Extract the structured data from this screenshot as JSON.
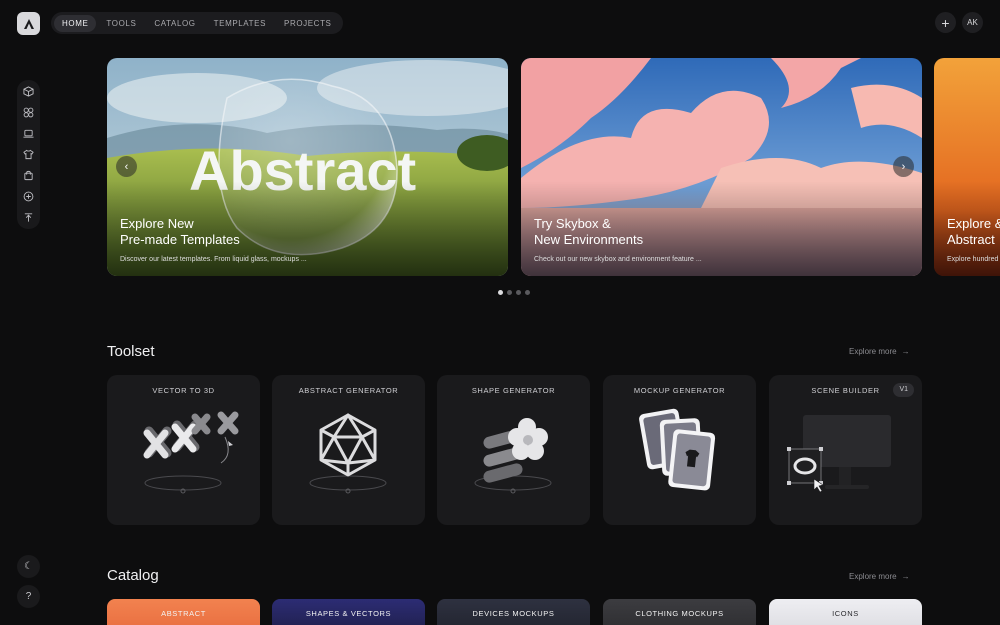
{
  "header": {
    "logo": "brand-logo",
    "nav": [
      {
        "label": "HOME",
        "active": true
      },
      {
        "label": "TOOLS"
      },
      {
        "label": "CATALOG"
      },
      {
        "label": "TEMPLATES"
      },
      {
        "label": "PROJECTS"
      }
    ],
    "add_icon": "+",
    "avatar_initials": "AK"
  },
  "sidebar": {
    "items": [
      "cube-icon",
      "shapes-icon",
      "laptop-icon",
      "tshirt-icon",
      "bag-icon",
      "plus-circle-icon",
      "upload-icon"
    ],
    "theme_icon": "☾",
    "help_icon": "?"
  },
  "hero": {
    "slides": [
      {
        "title_line1": "Explore New",
        "title_line2": "Pre-made Templates",
        "subtitle": "Discover our latest templates. From liquid glass, mockups ...",
        "art_word": "Abstract"
      },
      {
        "title_line1": "Try Skybox &",
        "title_line2": "New Environments",
        "subtitle": "Check out our new skybox and environment feature ..."
      },
      {
        "title_line1": "Explore &",
        "title_line2": "Abstract",
        "subtitle": "Explore hundred"
      }
    ],
    "prev_icon": "‹",
    "next_icon": "›",
    "active_dot": 0,
    "dot_count": 4
  },
  "toolset": {
    "title": "Toolset",
    "explore": "Explore more",
    "arrow": "→",
    "tools": [
      {
        "label": "VECTOR TO 3D"
      },
      {
        "label": "ABSTRACT GENERATOR"
      },
      {
        "label": "SHAPE GENERATOR"
      },
      {
        "label": "MOCKUP GENERATOR"
      },
      {
        "label": "SCENE BUILDER",
        "badge": "V1"
      }
    ]
  },
  "catalog": {
    "title": "Catalog",
    "explore": "Explore more",
    "arrow": "→",
    "items": [
      {
        "label": "ABSTRACT",
        "color": "#f0794a"
      },
      {
        "label": "SHAPES & VECTORS",
        "color": "#2a2a6a"
      },
      {
        "label": "DEVICES MOCKUPS",
        "color": "#2a2d3a"
      },
      {
        "label": "CLOTHING MOCKUPS",
        "color": "#3a3a3e"
      },
      {
        "label": "ICONS",
        "color": "#e6e6ea"
      }
    ]
  }
}
